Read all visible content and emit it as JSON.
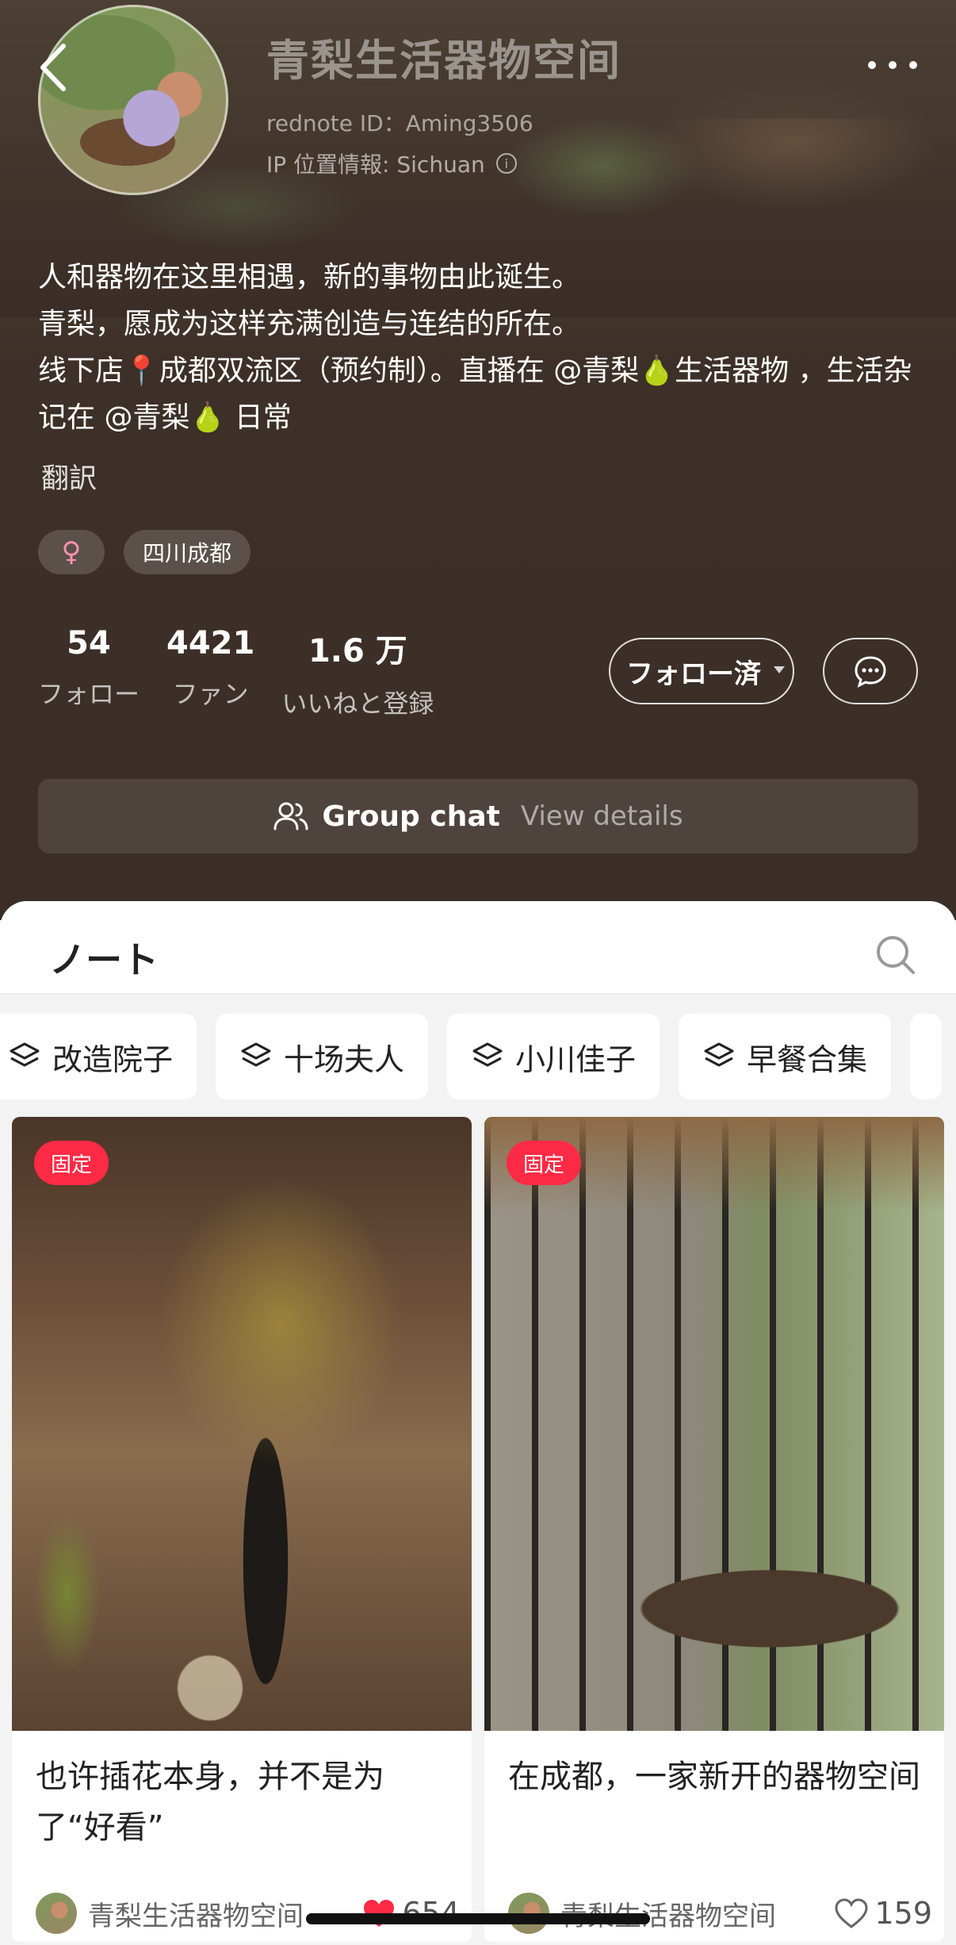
{
  "profile": {
    "name": "青梨生活器物空间",
    "rednote_id": "rednote ID：Aming3506",
    "ip_location": "IP 位置情報: Sichuan",
    "bio_lines": [
      "人和器物在这里相遇，新的事物由此诞生。",
      "青梨，愿成为这样充满创造与连结的所在。",
      "线下店📍成都双流区（预约制）。直播在 @青梨🍐生活器物 ，生活杂记在 @青梨🍐 日常"
    ],
    "translate_label": "翻訳",
    "tags": {
      "gender": "♀",
      "location": "四川成都"
    },
    "stats": [
      {
        "value": "54",
        "label": "フォロー"
      },
      {
        "value": "4421",
        "label": "ファン"
      },
      {
        "value": "1.6 万",
        "label": "いいねと登録"
      }
    ],
    "follow_label": "フォロー済",
    "group_chat": {
      "title": "Group chat",
      "link": "View details"
    }
  },
  "notes": {
    "title": "ノート",
    "collections": [
      "改造院子",
      "十场夫人",
      "小川佳子",
      "早餐合集"
    ],
    "cards": [
      {
        "pin": "固定",
        "title": "也许插花本身，并不是为了“好看”",
        "author": "青梨生活器物空间",
        "likes": "654",
        "liked": true
      },
      {
        "pin": "固定",
        "title": "在成都，一家新开的器物空间",
        "author": "青梨生活器物空间",
        "likes": "159",
        "liked": false
      }
    ]
  },
  "colors": {
    "accent": "#ff2a45",
    "header_bg": "#3a2e27"
  },
  "icons": [
    "back-arrow-icon",
    "more-icon",
    "info-icon",
    "message-icon",
    "group-icon",
    "search-icon",
    "layers-icon",
    "heart-icon"
  ]
}
